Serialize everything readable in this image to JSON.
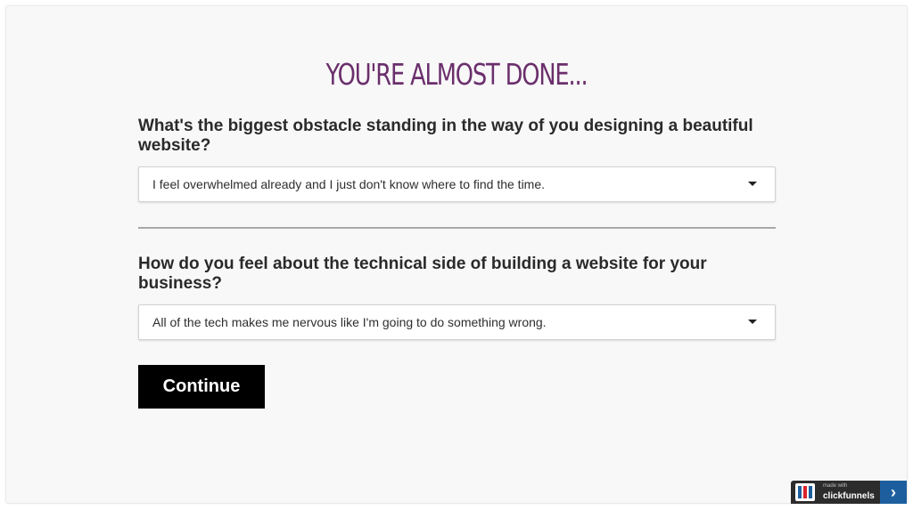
{
  "headline": "YOU'RE ALMOST DONE...",
  "question_1": {
    "label": "What's the biggest obstacle standing in the way of you designing a beautiful website?",
    "selected": "I feel overwhelmed already and I just don't know where to find the time."
  },
  "question_2": {
    "label": "How do you feel about the technical side of building a website for your business?",
    "selected": "All of the tech makes me nervous like I'm going to do something wrong."
  },
  "continue_button": "Continue",
  "badge": {
    "made_with": "made with",
    "brand": "clickfunnels",
    "arrow": "›"
  },
  "colors": {
    "headline": "#6b2f6c",
    "button_bg": "#000000",
    "badge_bg": "#2c2c2c",
    "badge_arrow_bg": "#1d5f9e"
  }
}
